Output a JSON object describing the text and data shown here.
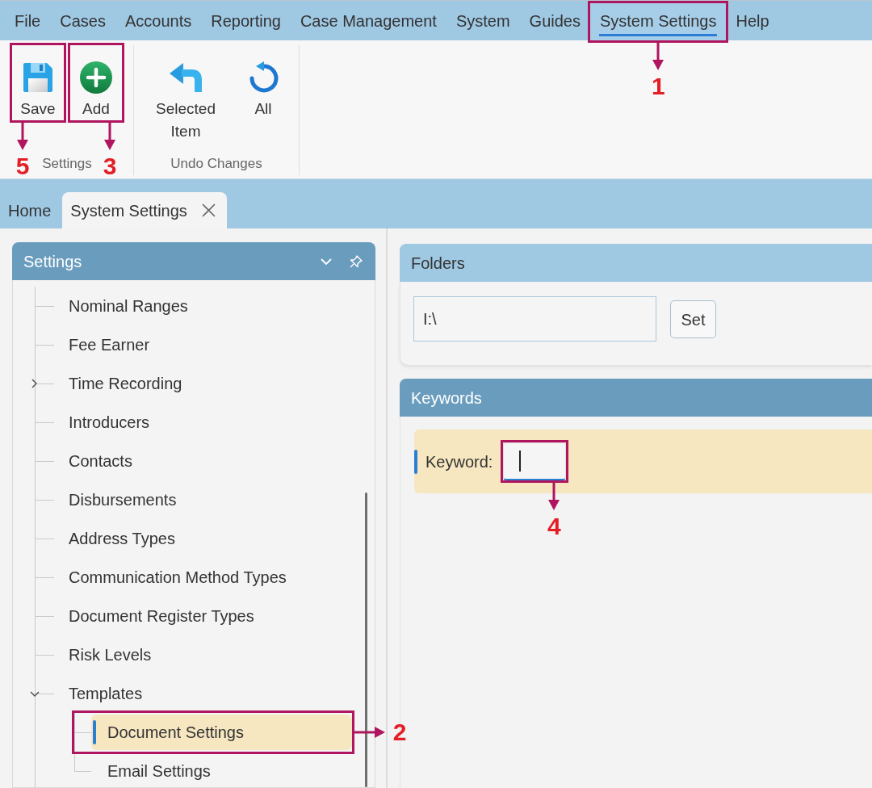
{
  "menu_bar": {
    "items": [
      {
        "label": "File",
        "selected": false
      },
      {
        "label": "Cases",
        "selected": false
      },
      {
        "label": "Accounts",
        "selected": false
      },
      {
        "label": "Reporting",
        "selected": false
      },
      {
        "label": "Case Management",
        "selected": false
      },
      {
        "label": "System",
        "selected": false
      },
      {
        "label": "Guides",
        "selected": false
      },
      {
        "label": "System Settings",
        "selected": true,
        "callout": "1"
      },
      {
        "label": "Help",
        "selected": false
      }
    ]
  },
  "ribbon": {
    "groups": [
      {
        "label": "Settings",
        "buttons": [
          {
            "label": "Save",
            "kind": "save",
            "callout": "5"
          },
          {
            "label": "Add",
            "kind": "add",
            "callout": "3"
          }
        ]
      },
      {
        "label": "Undo Changes",
        "buttons": [
          {
            "label": "Selected Item",
            "kind": "undo"
          },
          {
            "label": "All",
            "kind": "undo-all"
          }
        ]
      }
    ]
  },
  "tabs": [
    {
      "label": "Home",
      "selected": false,
      "closable": false
    },
    {
      "label": "System Settings",
      "selected": true,
      "closable": true
    }
  ],
  "settings_panel": {
    "title": "Settings",
    "active": true,
    "tree": [
      {
        "label": "Nominal Ranges",
        "selected": false
      },
      {
        "label": "Fee Earner",
        "selected": false
      },
      {
        "label": "Time Recording",
        "selected": false,
        "expanded": false
      },
      {
        "label": "Introducers",
        "selected": false
      },
      {
        "label": "Contacts",
        "selected": false
      },
      {
        "label": "Disbursements",
        "selected": false
      },
      {
        "label": "Address Types",
        "selected": false
      },
      {
        "label": "Communication Method Types",
        "selected": false
      },
      {
        "label": "Document Register Types",
        "selected": false
      },
      {
        "label": "Risk Levels",
        "selected": false
      },
      {
        "label": "Templates",
        "selected": false,
        "expanded": true,
        "children": [
          {
            "label": "Document Settings",
            "selected": true,
            "callout": "2"
          },
          {
            "label": "Email Settings",
            "selected": false
          }
        ]
      }
    ]
  },
  "folders_panel": {
    "title": "Folders",
    "active": false,
    "path": "I:\\",
    "button": "Set"
  },
  "keywords_panel": {
    "title": "Keywords",
    "active": true,
    "rows": [
      {
        "label": "Keyword:",
        "selected": true,
        "focused": true,
        "callout": "4"
      }
    ]
  }
}
